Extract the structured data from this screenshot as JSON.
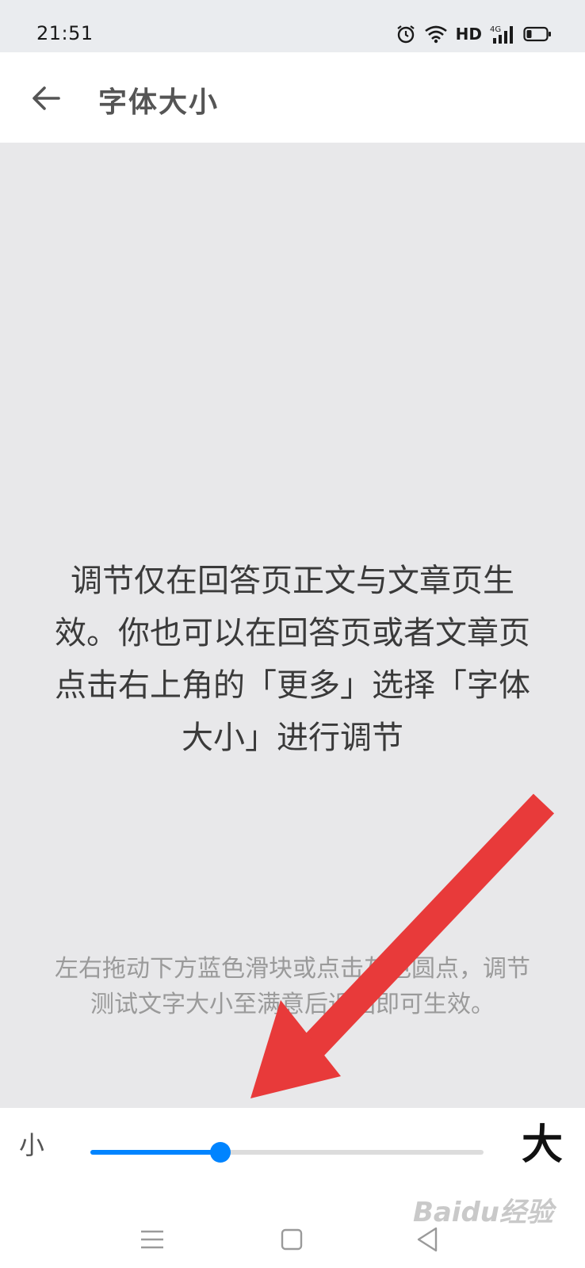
{
  "status_bar": {
    "time": "21:51",
    "network_label": "HD"
  },
  "app_bar": {
    "title": "字体大小"
  },
  "preview": {
    "text": "调节仅在回答页正文与文章页生效。你也可以在回答页或者文章页点击右上角的「更多」选择「字体大小」进行调节",
    "hint": "左右拖动下方蓝色滑块或点击灰色圆点，调节测试文字大小至满意后返回即可生效。"
  },
  "slider": {
    "label_small": "小",
    "label_large": "大",
    "value_fraction": 0.33
  },
  "colors": {
    "accent": "#0084ff",
    "annotation": "#e83a3a"
  },
  "icons": [
    "back-arrow-icon",
    "alarm-icon",
    "wifi-icon",
    "signal-4g-icon",
    "battery-icon",
    "menu-icon",
    "home-icon",
    "back-triangle-icon"
  ],
  "watermark": "Baidu经验"
}
